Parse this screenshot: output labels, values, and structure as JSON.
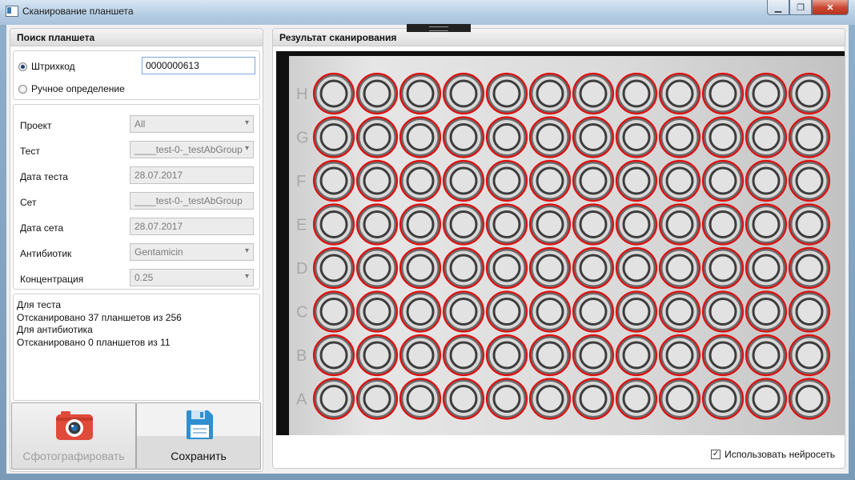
{
  "window": {
    "title": "Сканирование планшета",
    "minimize_label": "▁",
    "maximize_label": "❐",
    "close_label": "✕"
  },
  "left": {
    "header": "Поиск планшета",
    "mode": {
      "barcode_label": "Штрихкод",
      "barcode_value": "0000000613",
      "manual_label": "Ручное определение",
      "selected": "barcode"
    },
    "fields": [
      {
        "label": "Проект",
        "value": "All",
        "kind": "combo"
      },
      {
        "label": "Тест",
        "value": "____test-0-_testAbGroup",
        "kind": "combo"
      },
      {
        "label": "Дата теста",
        "value": "28.07.2017",
        "kind": "text"
      },
      {
        "label": "Сет",
        "value": "____test-0-_testAbGroup",
        "kind": "text"
      },
      {
        "label": "Дата сета",
        "value": "28.07.2017",
        "kind": "text"
      },
      {
        "label": "Антибиотик",
        "value": "Gentamicin",
        "kind": "combo"
      },
      {
        "label": "Концентрация",
        "value": "0.25",
        "kind": "combo"
      }
    ],
    "info_lines": [
      "Для теста",
      "Отсканировано 37 планшетов из 256",
      "Для антибиотика",
      "Отсканировано 0 планшетов из 11"
    ],
    "photo_button": "Сфотографировать",
    "save_button": "Сохранить"
  },
  "right": {
    "header": "Результат сканирования",
    "plate": {
      "rows": 8,
      "cols": 12,
      "row_letters": [
        "H",
        "G",
        "F",
        "E",
        "D",
        "C",
        "B",
        "A"
      ],
      "circle_color": "#e01010"
    },
    "use_nn_label": "Использовать нейросеть",
    "use_nn_checked": true
  },
  "colors": {
    "accent": "#3a7ab8",
    "camera_red": "#e04a3a",
    "save_blue": "#2f8fd0"
  }
}
